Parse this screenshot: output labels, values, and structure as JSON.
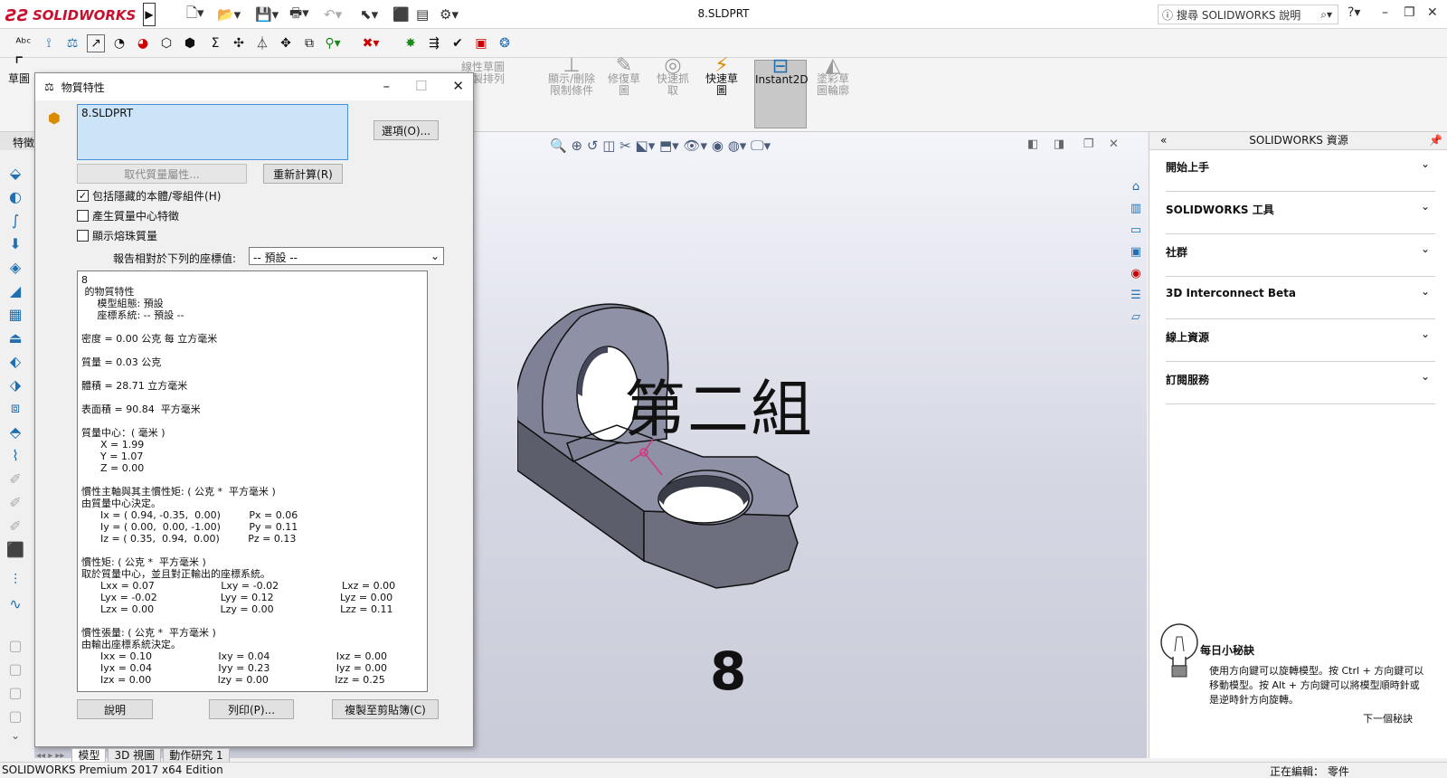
{
  "app": {
    "brand": "SOLIDWORKS",
    "doc_title": "8.SLDPRT",
    "help_search": "搜尋 SOLIDWORKS 說明"
  },
  "ribbon": {
    "sketch_label": "草圖",
    "feature_tab": "特徵",
    "display_delete": "顯示/刪除\n限制條件",
    "repair": "修復草\n圖",
    "quick_snap": "快速抓\n取",
    "rapid_sketch": "快速草\n圖",
    "instant2d": "Instant2D",
    "shaded_sketch": "塗彩草\n圖輪廓",
    "linear_pattern": "線性草圖\n複製排列"
  },
  "dialog": {
    "title": "物質特性",
    "selection": "8.SLDPRT",
    "options_btn": "選項(O)...",
    "override_btn": "取代質量屬性...",
    "recalc_btn": "重新計算(R)",
    "chk_hidden": "包括隱藏的本體/零組件(H)",
    "chk_hidden_on": true,
    "chk_center": "產生質量中心特徵",
    "chk_weld": "顯示熔珠質量",
    "coord_label": "報告相對於下列的座標值:",
    "coord_value": "-- 預設 --",
    "report": [
      "8",
      " 的物質特性",
      "     模型組態: 預設",
      "     座標系統: -- 預設 --",
      "",
      "密度 = 0.00 公克 每 立方毫米",
      "",
      "質量 = 0.03 公克",
      "",
      "體積 = 28.71 立方毫米",
      "",
      "表面積 = 90.84  平方毫米",
      "",
      "質量中心：( 毫米 )",
      "      X = 1.99",
      "      Y = 1.07",
      "      Z = 0.00",
      "",
      "慣性主軸與其主慣性矩: ( 公克 *  平方毫米 )",
      "由質量中心決定。",
      "      Ix = ( 0.94, -0.35,  0.00)         Px = 0.06",
      "      Iy = ( 0.00,  0.00, -1.00)         Py = 0.11",
      "      Iz = ( 0.35,  0.94,  0.00)         Pz = 0.13",
      "",
      "慣性矩: ( 公克 *  平方毫米 )",
      "取於質量中心，並且對正輸出的座標系統。",
      "      Lxx = 0.07                     Lxy = -0.02                    Lxz = 0.00",
      "      Lyx = -0.02                    Lyy = 0.12                     Lyz = 0.00",
      "      Lzx = 0.00                     Lzy = 0.00                     Lzz = 0.11",
      "",
      "慣性張量: ( 公克 *  平方毫米 )",
      "由輸出座標系統決定。",
      "      Ixx = 0.10                     Ixy = 0.04                     Ixz = 0.00",
      "      Iyx = 0.04                     Iyy = 0.23                     Iyz = 0.00",
      "      Izx = 0.00                     Izy = 0.00                     Izz = 0.25"
    ],
    "help_btn": "說明",
    "print_btn": "列印(P)...",
    "copy_btn": "複製至剪貼簿(C)"
  },
  "viewport": {
    "group_label": "第二組",
    "part_number": "8"
  },
  "tabs": [
    "模型",
    "3D 視圖",
    "動作研究 1"
  ],
  "status": {
    "edition": "SOLIDWORKS Premium 2017 x64 Edition",
    "editing": "正在編輯：  零件"
  },
  "resources": {
    "header": "SOLIDWORKS 資源",
    "sections": [
      "開始上手",
      "SOLIDWORKS 工具",
      "社群",
      "3D Interconnect Beta",
      "線上資源",
      "訂閱服務"
    ],
    "tip_title": "每日小秘訣",
    "tip_body": "使用方向鍵可以旋轉模型。按 Ctrl + 方向鍵可以移動模型。按 Alt + 方向鍵可以將模型順時針或是逆時針方向旋轉。",
    "tip_next": "下一個秘訣"
  }
}
